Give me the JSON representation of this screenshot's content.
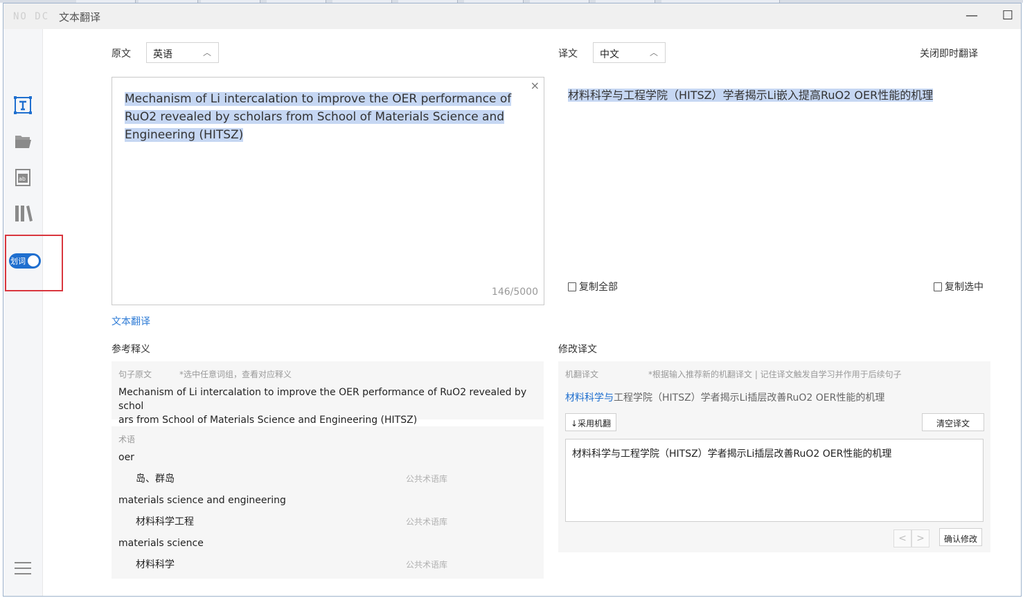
{
  "window": {
    "logo": "NO DC",
    "title": "文本翻译",
    "minimize": "—",
    "maximize": "☐"
  },
  "sidebar": {
    "icons": [
      "text-translate-icon",
      "folder-open-icon",
      "word-doc-icon",
      "library-icon"
    ],
    "toggle_label": "划词",
    "menu_icon": "hamburger-menu-icon"
  },
  "source": {
    "label": "原文",
    "language": "英语",
    "text": "Mechanism of Li intercalation to improve the OER performance of RuO2 revealed by scholars from School of Materials Science and Engineering (HITSZ)",
    "char_count": "146/5000",
    "clear": "×"
  },
  "target": {
    "label": "译文",
    "language": "中文",
    "close_instant": "关闭即时翻译",
    "text": "材料科学与工程学院（HITSZ）学者揭示Li嵌入提高RuO2 OER性能的机理",
    "copy_all": "复制全部",
    "copy_selected": "复制选中"
  },
  "mode_link": "文本翻译",
  "reference": {
    "title": "参考释义",
    "sentence_label": "句子原文",
    "sentence_hint": "*选中任意词组，查看对应释义",
    "sentence_line1": "Mechanism of Li intercalation to improve the OER performance of RuO2 revealed by schol",
    "sentence_line2": "ars from School of Materials Science and Engineering (HITSZ)",
    "terms_label": "术语",
    "terms": [
      {
        "term": "oer",
        "translation": "岛、群岛",
        "source": "公共术语库"
      },
      {
        "term": "materials science and engineering",
        "translation": "材料科学工程",
        "source": "公共术语库"
      },
      {
        "term": "materials science",
        "translation": "材料科学",
        "source": "公共术语库"
      }
    ]
  },
  "modify": {
    "title": "修改译文",
    "mt_label": "机翻译文",
    "mt_hint": "*根据输入推荐新的机翻译文 | 记住译文触发自学习并作用于后续句子",
    "mt_highlight": "材料科学与",
    "mt_rest": "工程学院（HITSZ）学者揭示Li插层改善RuO2 OER性能的机理",
    "use_mt_button": "↓采用机翻",
    "clear_button": "清空译文",
    "edit_text": "材料科学与工程学院（HITSZ）学者揭示Li插层改善RuO2 OER性能的机理",
    "prev": "<",
    "next": ">",
    "confirm_button": "确认修改"
  },
  "colors": {
    "accent": "#1f6fcf",
    "link": "#2f7cd6",
    "highlight": "#c6d7f3",
    "annotation_box": "#d9363e"
  }
}
